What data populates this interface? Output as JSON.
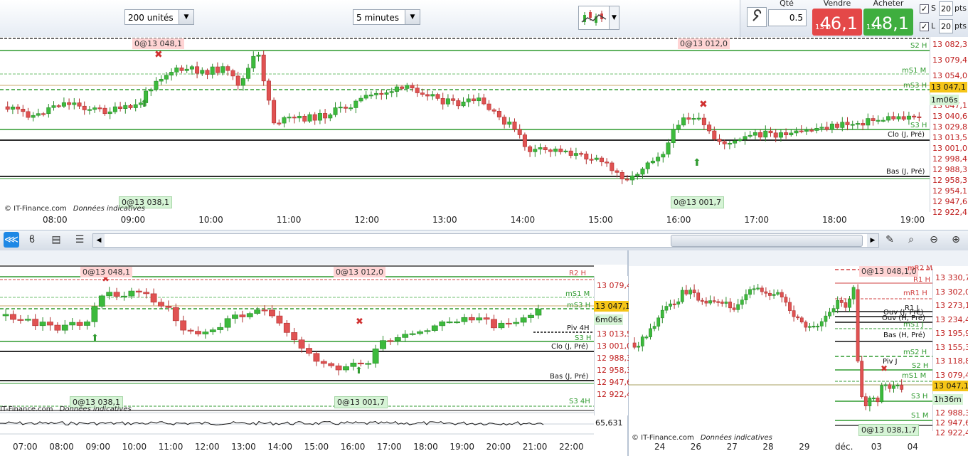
{
  "toolbar": {
    "units_select": "200 unités",
    "interval_select": "5 minutes",
    "qty_label": "Qté",
    "qty_value": "0.5",
    "sell_label": "Vendre",
    "sell_prefix": "13 0",
    "sell_price": "46,1",
    "buy_label": "Acheter",
    "buy_prefix": "13 0",
    "buy_price": "48,1",
    "stop_label": "S",
    "stop_pts": "20",
    "limit_label": "L",
    "limit_pts": "20",
    "pts_label": "pts",
    "check_mark": "✓"
  },
  "colors": {
    "bull": "#3cba3c",
    "bear": "#e05252",
    "pivot_green": "#2f9a2f",
    "level_red": "#d04040",
    "price_badge": "#f5c518"
  },
  "main_chart": {
    "tags": {
      "high_left": "0@13 048,1",
      "high_right": "0@13 012,0",
      "low_left": "0@13 038,1",
      "low_right": "0@13 001,7"
    },
    "levels": {
      "s2h": "S2 H",
      "ms1m": "mS1 M",
      "ms3h": "mS3 H",
      "s3h": "S3 H",
      "clo": "Clo (J, Pré)",
      "bas": "Bas (J, Pré)"
    },
    "y_axis": [
      "13 082,3",
      "13 079,4",
      "13 054,0",
      "13 047,1",
      "13 040,6",
      "13 029,8",
      "13 013,5",
      "13 001,0",
      "12 998,4",
      "12 988,3",
      "12 958,3",
      "12 954,1",
      "12 947,6",
      "12 922,4"
    ],
    "price_badge": "13 047,1",
    "timer_badge": "1m06s",
    "x_axis": [
      "08:00",
      "09:00",
      "10:00",
      "11:00",
      "12:00",
      "13:00",
      "14:00",
      "15:00",
      "16:00",
      "17:00",
      "18:00",
      "19:00"
    ],
    "copyright": "© IT-Finance.com",
    "disclaimer": "Données indicatives"
  },
  "nav_icons": [
    "share-icon",
    "indicator-icon",
    "notes-icon",
    "layers-icon"
  ],
  "bottom_left_chart": {
    "tags": {
      "high_left": "0@13 048,1",
      "high_right": "0@13 012,0",
      "low_left": "0@13 038,1",
      "low_right": "0@13 001,7"
    },
    "levels": {
      "r2h": "R2 H",
      "ms1m": "mS1 M",
      "ms3h": "mS3 H",
      "piv4h": "Piv 4H",
      "s3h": "S3 H",
      "clo": "Clo (J, Pré)",
      "bas": "Bas (J, Pré)",
      "s34h": "S3 4H"
    },
    "y_axis": [
      "13 079,4",
      "13 047,1",
      "13 013,5",
      "13 001,0",
      "12 988,3",
      "12 958,3",
      "12 947,6",
      "12 922,4"
    ],
    "price_badge": "13 047,1",
    "timer_badge": "6m06s",
    "indicator_value": "65,631",
    "x_axis": [
      "07:00",
      "08:00",
      "09:00",
      "10:00",
      "11:00",
      "12:00",
      "13:00",
      "14:00",
      "15:00",
      "16:00",
      "17:00",
      "18:00",
      "19:00",
      "20:00",
      "21:00",
      "22:00"
    ],
    "copyright": "IT-Finance.com",
    "disclaimer": "Données indicatives"
  },
  "bottom_right_chart": {
    "tags": {
      "high": "0@13 048,1,0",
      "low": "0@13 038,1,7"
    },
    "levels": {
      "mr2": "mR2 M",
      "r1h": "R1 H",
      "mr1h": "mR1 H",
      "r1j": "R1 J",
      "ouvj": "Ouv (J, Pré)",
      "ouvh": "Ouv (H, Pré)",
      "ms1": "mS1 J",
      "bas": "Bas (H, Pré)",
      "ms2h": "mS2 H",
      "s2h": "S2 H",
      "pivj": "Piv J",
      "ms1m": "mS1 M",
      "s3h": "S3 H",
      "s1m": "S1 M"
    },
    "y_axis": [
      "13 330,7",
      "13 302,0",
      "13 273,1",
      "13 234,4",
      "13 195,9",
      "13 155,3",
      "13 118,8",
      "13 079,4",
      "13 047,1",
      "12 988,3",
      "12 947,6",
      "12 922,4"
    ],
    "price_badge": "13 047,1",
    "timer_badge": "1h36m",
    "x_axis": [
      "24",
      "26",
      "27",
      "28",
      "29",
      "déc.",
      "03",
      "04"
    ],
    "copyright": "© IT-Finance.com",
    "disclaimer": "Données indicatives"
  }
}
